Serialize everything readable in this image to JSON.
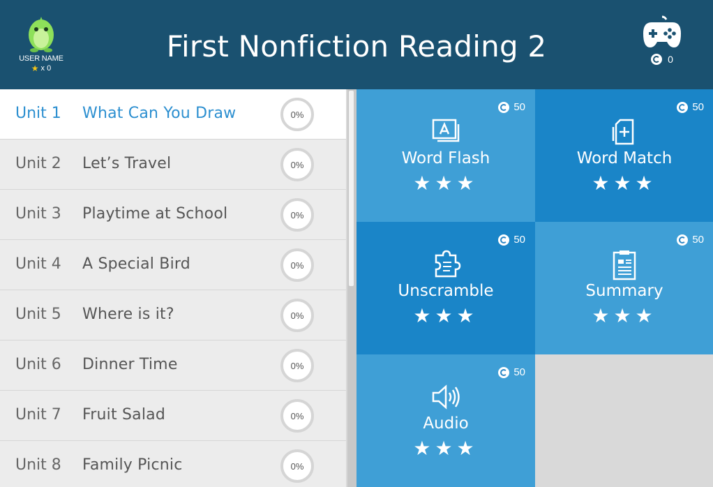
{
  "header": {
    "title": "First Nonfiction Reading 2",
    "user_name": "USER NAME",
    "star_count": "x 0",
    "coins": "0"
  },
  "units": [
    {
      "unit": "Unit 1",
      "title": "What Can You Draw",
      "progress": "0%",
      "active": true
    },
    {
      "unit": "Unit 2",
      "title": "Let’s Travel",
      "progress": "0%"
    },
    {
      "unit": "Unit 3",
      "title": "Playtime at School",
      "progress": "0%"
    },
    {
      "unit": "Unit 4",
      "title": "A Special Bird",
      "progress": "0%"
    },
    {
      "unit": "Unit 5",
      "title": "Where is it?",
      "progress": "0%"
    },
    {
      "unit": "Unit 6",
      "title": "Dinner Time",
      "progress": "0%"
    },
    {
      "unit": "Unit 7",
      "title": "Fruit Salad",
      "progress": "0%"
    },
    {
      "unit": "Unit 8",
      "title": "Family Picnic",
      "progress": "0%"
    }
  ],
  "activities": [
    {
      "label": "Word Flash",
      "cost": "50",
      "stars": "★★★",
      "icon": "flashcard-icon"
    },
    {
      "label": "Word Match",
      "cost": "50",
      "stars": "★★★",
      "icon": "cards-plus-icon"
    },
    {
      "label": "Unscramble",
      "cost": "50",
      "stars": "★★★",
      "icon": "puzzle-icon"
    },
    {
      "label": "Summary",
      "cost": "50",
      "stars": "★★★",
      "icon": "clipboard-icon"
    },
    {
      "label": "Audio",
      "cost": "50",
      "stars": "★★★",
      "icon": "speaker-icon"
    }
  ],
  "colors": {
    "header_bg": "#1a5170",
    "tile_light": "#3f9fd6",
    "tile_dark": "#1a85c8",
    "active_text": "#2c8fd0"
  }
}
